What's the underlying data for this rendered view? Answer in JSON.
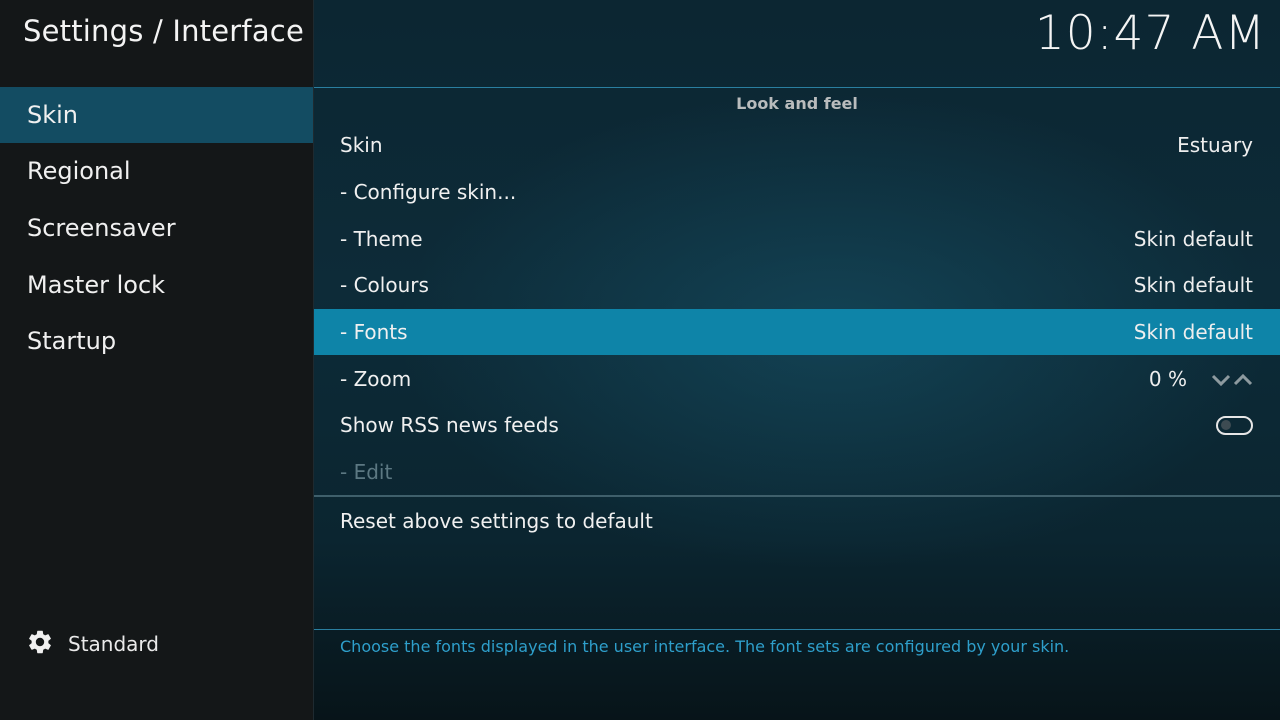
{
  "header": {
    "title": "Settings / Interface",
    "clock": "10:47 AM"
  },
  "sidebar": {
    "items": [
      {
        "label": "Skin",
        "active": true
      },
      {
        "label": "Regional"
      },
      {
        "label": "Screensaver"
      },
      {
        "label": "Master lock"
      },
      {
        "label": "Startup"
      }
    ],
    "level_icon": "gear-icon",
    "level_label": "Standard"
  },
  "main": {
    "section_title": "Look and feel",
    "rows": [
      {
        "label": "Skin",
        "value": "Estuary"
      },
      {
        "label": "- Configure skin..."
      },
      {
        "label": "- Theme",
        "value": "Skin default"
      },
      {
        "label": "- Colours",
        "value": "Skin default"
      },
      {
        "label": "- Fonts",
        "value": "Skin default",
        "focused": true
      },
      {
        "label": "- Zoom",
        "value": "0 %",
        "icons": [
          "chevron-down-icon",
          "chevron-up-icon"
        ]
      },
      {
        "label": "Show RSS news feeds",
        "toggle": false,
        "icon": "toggle-switch-icon"
      },
      {
        "label": "- Edit",
        "disabled": true
      }
    ],
    "reset_label": "Reset above settings to default",
    "description": "Choose the fonts displayed in the user interface. The font sets are configured by your skin."
  },
  "colors": {
    "accent": "#0e84a8",
    "sidebar_active": "#134c62",
    "description_text": "#2e9fcb"
  }
}
